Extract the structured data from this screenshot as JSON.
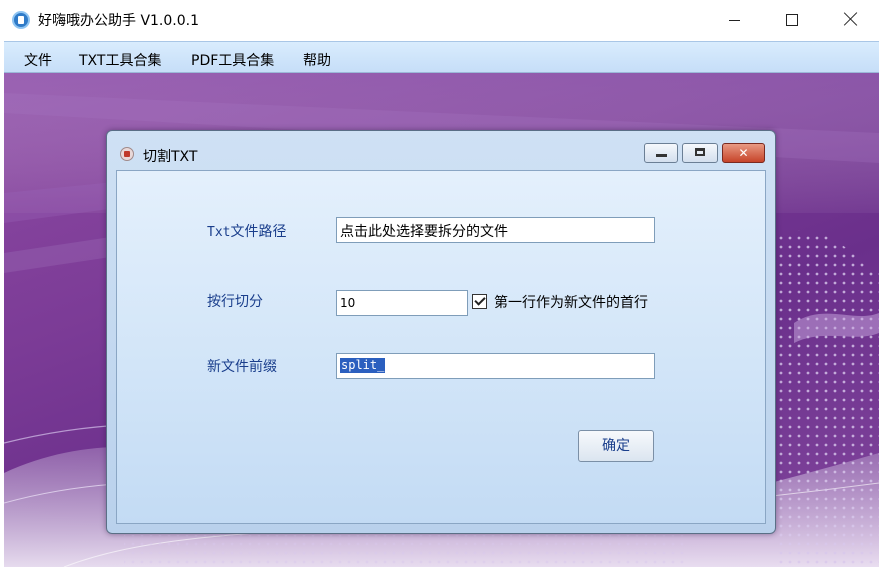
{
  "window": {
    "title": "好嗨哦办公助手 V1.0.0.1",
    "icon": "app-icon",
    "controls": {
      "minimize": "minimize-icon",
      "maximize": "maximize-icon",
      "close": "close-icon"
    }
  },
  "menu": {
    "items": [
      {
        "label": "文件"
      },
      {
        "label": "TXT工具合集"
      },
      {
        "label": "PDF工具合集"
      },
      {
        "label": "帮助"
      }
    ]
  },
  "dialog": {
    "title": "切割TXT",
    "icon": "split-txt-icon",
    "close_glyph": "✕",
    "fields": {
      "path_label_prefix": "Txt",
      "path_label_suffix": "文件路径",
      "path_value": "点击此处选择要拆分的文件",
      "lines_label": "按行切分",
      "lines_value": "10",
      "first_line_checkbox_label": "第一行作为新文件的首行",
      "first_line_checked": true,
      "prefix_label": "新文件前缀",
      "prefix_value": "split_"
    },
    "confirm_label": "确定"
  },
  "colors": {
    "background_purple": "#7b3b96",
    "dialog_blue": "#cfe1f4",
    "label_blue": "#1a3e8c",
    "selection_blue": "#2b5fbf",
    "close_red": "#c6442a"
  }
}
